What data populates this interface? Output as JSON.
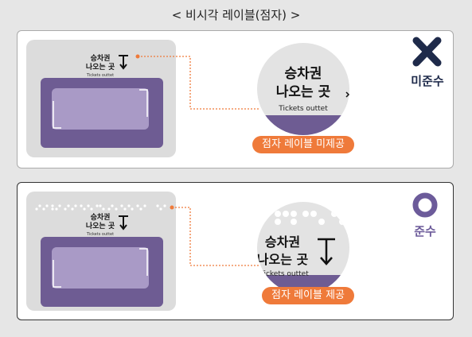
{
  "title": "< 비시각 레이블(점자) >",
  "panels": [
    {
      "id": "non-compliant",
      "device_label_line1": "승차권",
      "device_label_line2": "나오는 곳",
      "device_label_en": "Tickets outtet",
      "zoom_line1": "승차권",
      "zoom_line2": "나오는 곳",
      "zoom_en": "Tickets outtet",
      "pill": "점자 레이블 미제공",
      "verdict": "미준수",
      "verdict_icon": "x-icon",
      "verdict_color": "#1e2a4a"
    },
    {
      "id": "compliant",
      "device_label_line1": "승차권",
      "device_label_line2": "나오는 곳",
      "device_label_en": "Tickets outtet",
      "zoom_line1": "승차권",
      "zoom_line2": "나오는 곳",
      "zoom_en": "Tickets outtet",
      "pill": "점자 레이블 제공",
      "verdict": "준수",
      "verdict_icon": "circle-icon",
      "verdict_color": "#6c5b9a"
    }
  ],
  "colors": {
    "accent": "#ef7a3a",
    "device_purple": "#6e5c93",
    "device_gray": "#dcdcdc"
  }
}
